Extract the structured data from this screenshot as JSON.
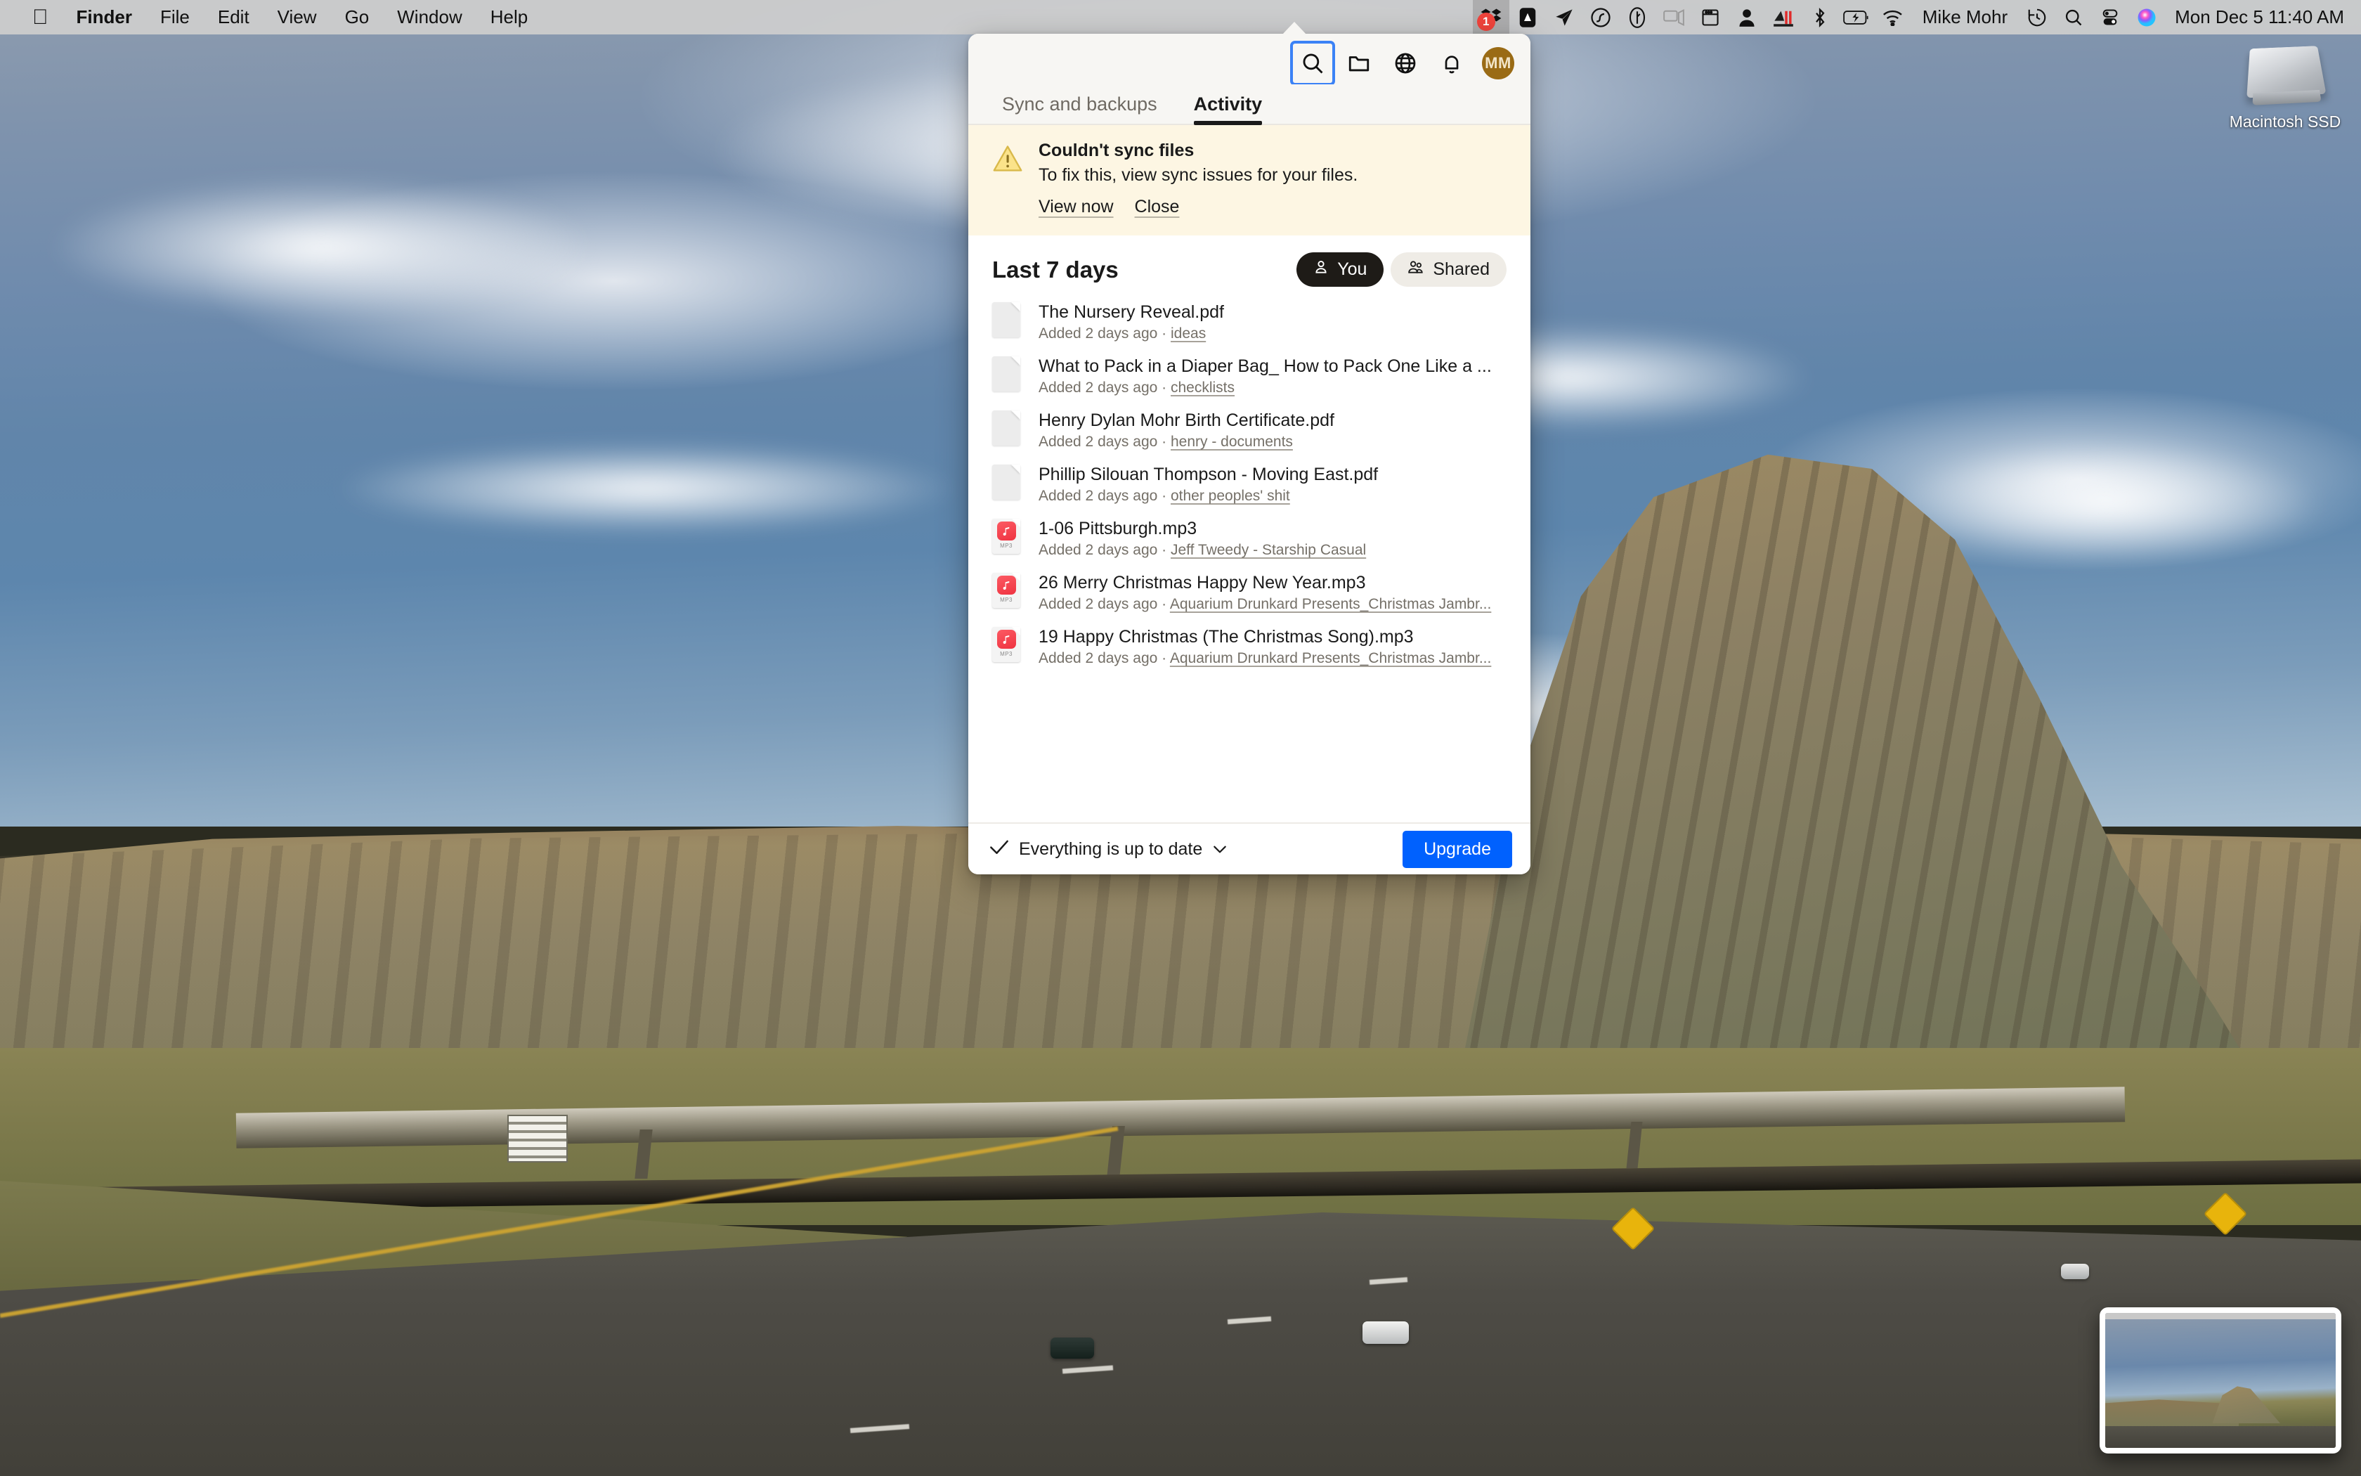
{
  "menubar": {
    "apple_glyph": "apple-logo",
    "items": [
      {
        "label": "Finder",
        "bold": true
      },
      {
        "label": "File",
        "bold": false
      },
      {
        "label": "Edit",
        "bold": false
      },
      {
        "label": "View",
        "bold": false
      },
      {
        "label": "Go",
        "bold": false
      },
      {
        "label": "Window",
        "bold": false
      },
      {
        "label": "Help",
        "bold": false
      }
    ],
    "status_icons": [
      {
        "name": "dropbox-menu-icon",
        "badge": "1",
        "active": true
      },
      {
        "name": "adobe-acrobat-icon",
        "badge": "",
        "active": false
      },
      {
        "name": "location-arrow-icon",
        "badge": "",
        "active": false
      },
      {
        "name": "creative-cloud-icon",
        "badge": "",
        "active": false
      },
      {
        "name": "1password-icon",
        "badge": "",
        "active": false
      },
      {
        "name": "airplay-icon",
        "badge": "",
        "active": false
      },
      {
        "name": "window-manager-icon",
        "badge": "",
        "active": false
      },
      {
        "name": "user-account-icon",
        "badge": "",
        "active": false
      },
      {
        "name": "backblaze-icon",
        "badge": "",
        "active": false
      },
      {
        "name": "bluetooth-icon",
        "badge": "",
        "active": false
      },
      {
        "name": "battery-charging-icon",
        "badge": "",
        "active": false
      },
      {
        "name": "wifi-icon",
        "badge": "",
        "active": false
      }
    ],
    "user_name": "Mike Mohr",
    "right_icons": [
      {
        "name": "time-machine-icon"
      },
      {
        "name": "spotlight-search-icon"
      },
      {
        "name": "control-center-icon"
      },
      {
        "name": "siri-icon"
      }
    ],
    "clock": "Mon Dec 5  11:40 AM"
  },
  "desktop": {
    "drive": {
      "label": "Macintosh SSD",
      "icon": "ssd-drive-icon"
    },
    "screenshot_thumbnail": {
      "name": "screenshot-thumbnail"
    }
  },
  "panel": {
    "header_icons": [
      {
        "name": "search-icon",
        "focused": true
      },
      {
        "name": "folder-icon",
        "focused": false
      },
      {
        "name": "globe-icon",
        "focused": false
      },
      {
        "name": "bell-icon",
        "focused": false
      }
    ],
    "avatar_initials": "MM",
    "avatar_color": "#9a6b15",
    "tabs": [
      {
        "label": "Sync and backups",
        "active": false
      },
      {
        "label": "Activity",
        "active": true
      }
    ],
    "banner": {
      "icon": "warning-triangle-icon",
      "title": "Couldn't sync files",
      "text": "To fix this, view sync issues for your files.",
      "primary_action": "View now",
      "secondary_action": "Close",
      "background": "#fdf6e3"
    },
    "list": {
      "title": "Last 7 days",
      "segments": [
        {
          "label": "You",
          "icon": "person-icon",
          "active": true
        },
        {
          "label": "Shared",
          "icon": "people-icon",
          "active": false
        }
      ],
      "files": [
        {
          "icon": "document-icon",
          "name": "The Nursery Reveal.pdf",
          "added": "Added 2 days ago",
          "separator": " · ",
          "folder": "ideas"
        },
        {
          "icon": "document-icon",
          "name": "What to Pack in a Diaper Bag_ How to Pack One Like a ...",
          "added": "Added 2 days ago",
          "separator": " · ",
          "folder": "checklists"
        },
        {
          "icon": "document-icon",
          "name": "Henry Dylan Mohr Birth Certificate.pdf",
          "added": "Added 2 days ago",
          "separator": " · ",
          "folder": "henry - documents"
        },
        {
          "icon": "document-icon",
          "name": "Phillip Silouan Thompson - Moving East.pdf",
          "added": "Added 2 days ago",
          "separator": " · ",
          "folder": "other peoples' shit"
        },
        {
          "icon": "mp3-icon",
          "name": "1-06 Pittsburgh.mp3",
          "added": "Added 2 days ago",
          "separator": " · ",
          "folder": "Jeff Tweedy - Starship Casual"
        },
        {
          "icon": "mp3-icon",
          "name": "26 Merry Christmas Happy New Year.mp3",
          "added": "Added 2 days ago",
          "separator": " · ",
          "folder": "Aquarium Drunkard Presents_Christmas Jambr..."
        },
        {
          "icon": "mp3-icon",
          "name": "19 Happy Christmas (The Christmas Song).mp3",
          "added": "Added 2 days ago",
          "separator": " · ",
          "folder": "Aquarium Drunkard Presents_Christmas Jambr..."
        }
      ]
    },
    "footer": {
      "status_icon": "checkmark-icon",
      "status_text": "Everything is up to date",
      "chevron": "chevron-down-icon",
      "upgrade_label": "Upgrade",
      "upgrade_color": "#0061fe"
    }
  }
}
